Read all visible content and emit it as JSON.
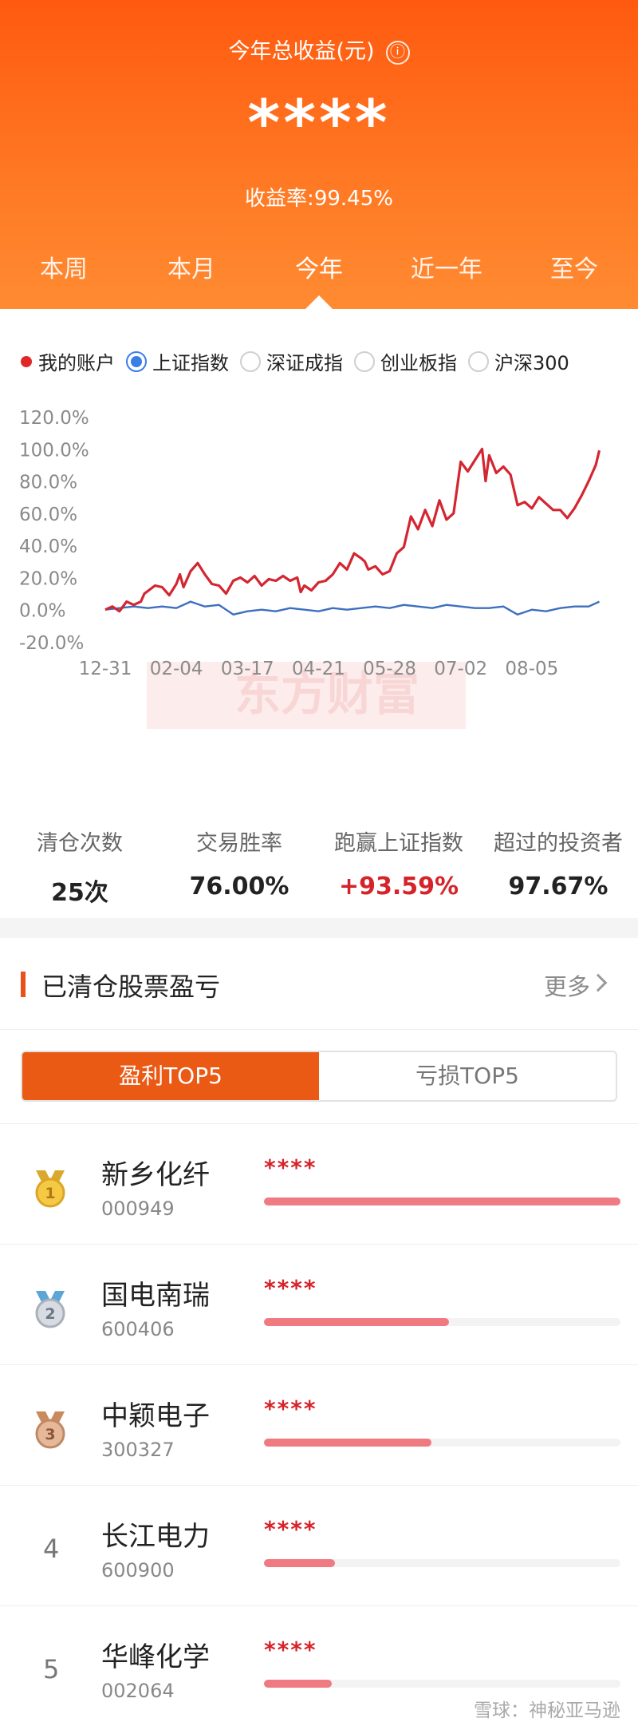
{
  "header": {
    "title": "今年总收益(元)",
    "info_icon": "ⓘ",
    "amount": "****",
    "rate_label": "收益率:",
    "rate_value": "99.45%"
  },
  "tabs": [
    {
      "label": "本周"
    },
    {
      "label": "本月"
    },
    {
      "label": "今年",
      "active": true
    },
    {
      "label": "近一年"
    },
    {
      "label": "至今"
    }
  ],
  "legend": [
    {
      "label": "我的账户",
      "kind": "dot",
      "color": "#e02828"
    },
    {
      "label": "上证指数",
      "kind": "radio",
      "selected": true,
      "color": "#3a7ee6"
    },
    {
      "label": "深证成指",
      "kind": "radio"
    },
    {
      "label": "创业板指",
      "kind": "radio"
    },
    {
      "label": "沪深300",
      "kind": "radio"
    }
  ],
  "chart_data": {
    "type": "line",
    "watermark": "东方财富",
    "y_ticks": [
      "120.0%",
      "100.0%",
      "80.0%",
      "60.0%",
      "40.0%",
      "20.0%",
      "0.0%",
      "-20.0%"
    ],
    "ylim": [
      -20,
      120
    ],
    "x_ticks": [
      {
        "label": "12-31",
        "t": 0
      },
      {
        "label": "02-04",
        "t": 1
      },
      {
        "label": "03-17",
        "t": 2
      },
      {
        "label": "04-21",
        "t": 3
      },
      {
        "label": "05-28",
        "t": 4
      },
      {
        "label": "07-02",
        "t": 5
      },
      {
        "label": "08-05",
        "t": 6
      }
    ],
    "series": [
      {
        "name": "我的账户",
        "color": "#d32630",
        "points": [
          [
            0,
            0
          ],
          [
            0.1,
            2
          ],
          [
            0.2,
            -1
          ],
          [
            0.3,
            5
          ],
          [
            0.4,
            3
          ],
          [
            0.5,
            5
          ],
          [
            0.55,
            10
          ],
          [
            0.7,
            15
          ],
          [
            0.8,
            14
          ],
          [
            0.9,
            9
          ],
          [
            1.0,
            16
          ],
          [
            1.05,
            22
          ],
          [
            1.1,
            14
          ],
          [
            1.2,
            24
          ],
          [
            1.3,
            29
          ],
          [
            1.4,
            22
          ],
          [
            1.5,
            16
          ],
          [
            1.6,
            15
          ],
          [
            1.7,
            10
          ],
          [
            1.8,
            18
          ],
          [
            1.9,
            20
          ],
          [
            2.0,
            17
          ],
          [
            2.1,
            21
          ],
          [
            2.2,
            15
          ],
          [
            2.3,
            19
          ],
          [
            2.4,
            18
          ],
          [
            2.5,
            21
          ],
          [
            2.6,
            18
          ],
          [
            2.7,
            20
          ],
          [
            2.75,
            11
          ],
          [
            2.8,
            15
          ],
          [
            2.9,
            12
          ],
          [
            3.0,
            17
          ],
          [
            3.1,
            18
          ],
          [
            3.2,
            22
          ],
          [
            3.3,
            29
          ],
          [
            3.4,
            25
          ],
          [
            3.5,
            35
          ],
          [
            3.6,
            32
          ],
          [
            3.65,
            30
          ],
          [
            3.7,
            25
          ],
          [
            3.8,
            27
          ],
          [
            3.9,
            22
          ],
          [
            4.0,
            24
          ],
          [
            4.1,
            35
          ],
          [
            4.2,
            39
          ],
          [
            4.3,
            58
          ],
          [
            4.4,
            50
          ],
          [
            4.5,
            62
          ],
          [
            4.6,
            52
          ],
          [
            4.7,
            68
          ],
          [
            4.8,
            56
          ],
          [
            4.9,
            60
          ],
          [
            5.0,
            92
          ],
          [
            5.1,
            86
          ],
          [
            5.2,
            93
          ],
          [
            5.3,
            100
          ],
          [
            5.35,
            80
          ],
          [
            5.4,
            96
          ],
          [
            5.5,
            85
          ],
          [
            5.6,
            89
          ],
          [
            5.7,
            84
          ],
          [
            5.8,
            65
          ],
          [
            5.9,
            67
          ],
          [
            6.0,
            63
          ],
          [
            6.1,
            70
          ],
          [
            6.2,
            66
          ],
          [
            6.3,
            62
          ],
          [
            6.4,
            62
          ],
          [
            6.5,
            57
          ],
          [
            6.6,
            63
          ],
          [
            6.7,
            71
          ],
          [
            6.8,
            80
          ],
          [
            6.9,
            90
          ],
          [
            6.95,
            99
          ]
        ]
      },
      {
        "name": "上证指数",
        "color": "#3e6fbf",
        "points": [
          [
            0,
            0
          ],
          [
            0.2,
            1
          ],
          [
            0.4,
            2
          ],
          [
            0.6,
            1
          ],
          [
            0.8,
            2
          ],
          [
            1.0,
            1
          ],
          [
            1.2,
            5
          ],
          [
            1.4,
            2
          ],
          [
            1.6,
            3
          ],
          [
            1.8,
            -3
          ],
          [
            2.0,
            -1
          ],
          [
            2.2,
            0
          ],
          [
            2.4,
            -1
          ],
          [
            2.6,
            1
          ],
          [
            2.8,
            0
          ],
          [
            3.0,
            -1
          ],
          [
            3.2,
            1
          ],
          [
            3.4,
            0
          ],
          [
            3.6,
            1
          ],
          [
            3.8,
            2
          ],
          [
            4.0,
            1
          ],
          [
            4.2,
            3
          ],
          [
            4.4,
            2
          ],
          [
            4.6,
            1
          ],
          [
            4.8,
            3
          ],
          [
            5.0,
            2
          ],
          [
            5.2,
            1
          ],
          [
            5.4,
            1
          ],
          [
            5.6,
            2
          ],
          [
            5.8,
            -3
          ],
          [
            6.0,
            0
          ],
          [
            6.2,
            -1
          ],
          [
            6.4,
            1
          ],
          [
            6.6,
            2
          ],
          [
            6.8,
            2
          ],
          [
            6.95,
            5
          ]
        ]
      }
    ]
  },
  "stats": [
    {
      "label": "清仓次数",
      "value": "25次"
    },
    {
      "label": "交易胜率",
      "value": "76.00%"
    },
    {
      "label": "跑赢上证指数",
      "value": "+93.59%",
      "highlight": true
    },
    {
      "label": "超过的投资者",
      "value": "97.67%"
    }
  ],
  "cleared": {
    "title": "已清仓股票盈亏",
    "more": "更多",
    "tabs": [
      {
        "label": "盈利TOP5",
        "active": true
      },
      {
        "label": "亏损TOP5"
      }
    ],
    "items": [
      {
        "rank": "1",
        "medal": "gold",
        "name": "新乡化纤",
        "code": "000949",
        "profit": "****",
        "ratio": 1.0
      },
      {
        "rank": "2",
        "medal": "silver",
        "name": "国电南瑞",
        "code": "600406",
        "profit": "****",
        "ratio": 0.52
      },
      {
        "rank": "3",
        "medal": "bronze",
        "name": "中颖电子",
        "code": "300327",
        "profit": "****",
        "ratio": 0.47
      },
      {
        "rank": "4",
        "name": "长江电力",
        "code": "600900",
        "profit": "****",
        "ratio": 0.2
      },
      {
        "rank": "5",
        "name": "华峰化学",
        "code": "002064",
        "profit": "****",
        "ratio": 0.19
      }
    ]
  },
  "footer_watermark": "雪球：神秘亚马逊",
  "colors": {
    "brand_orange": "#ff6a18",
    "profit_red": "#d6232a",
    "bar_pink": "#f07a82"
  }
}
